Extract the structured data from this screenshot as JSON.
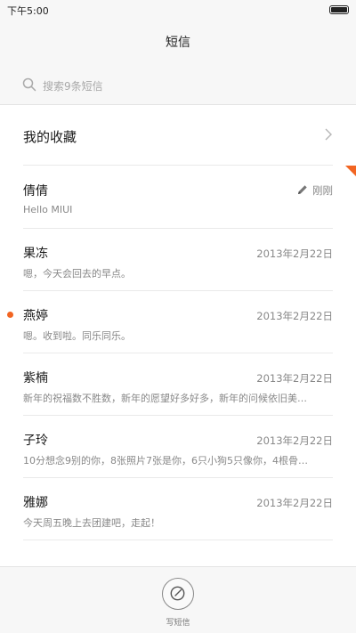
{
  "status_bar": {
    "time": "下午5:00"
  },
  "header": {
    "title": "短信"
  },
  "search": {
    "placeholder": "搜索9条短信"
  },
  "favorites": {
    "label": "我的收藏"
  },
  "conversations": [
    {
      "name": "倩倩",
      "preview": "Hello MIUI",
      "time": "刚刚",
      "unread": false,
      "draft": true
    },
    {
      "name": "果冻",
      "preview": "嗯，今天会回去的早点。",
      "time": "2013年2月22日",
      "unread": false
    },
    {
      "name": "燕婷",
      "preview": "嗯。收到啦。同乐同乐。",
      "time": "2013年2月22日",
      "unread": true
    },
    {
      "name": "紫楠",
      "preview": "新年的祝福数不胜数，新年的愿望好多好多，新年的问候依旧美…",
      "time": "2013年2月22日",
      "unread": false
    },
    {
      "name": "子玲",
      "preview": "10分想念9别的你，8张照片7张是你，6只小狗5只像你，4根骨…",
      "time": "2013年2月22日",
      "unread": false
    },
    {
      "name": "雅娜",
      "preview": "今天周五晚上去团建吧，走起！",
      "time": "2013年2月22日",
      "unread": false
    }
  ],
  "compose": {
    "label": "写短信",
    "icon": "compose-icon"
  },
  "colors": {
    "accent": "#f26522",
    "background": "#f7f7f7"
  }
}
